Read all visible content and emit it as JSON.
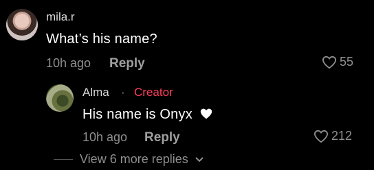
{
  "comment": {
    "username": "mila.r",
    "text": "What’s his name?",
    "time": "10h ago",
    "reply_label": "Reply",
    "likes": "55",
    "like_icon": "heart-outline-icon"
  },
  "reply": {
    "username": "Alma",
    "separator": "·",
    "badge": "Creator",
    "text": "His name is Onyx",
    "text_emoji": "white-heart-emoji",
    "time": "10h ago",
    "reply_label": "Reply",
    "likes": "212",
    "like_icon": "heart-outline-icon"
  },
  "view_more": {
    "label": "View 6 more replies",
    "icon": "chevron-down-icon"
  },
  "colors": {
    "background": "#000000",
    "creator": "#ff3b5c",
    "muted": "#8f8f8f"
  }
}
